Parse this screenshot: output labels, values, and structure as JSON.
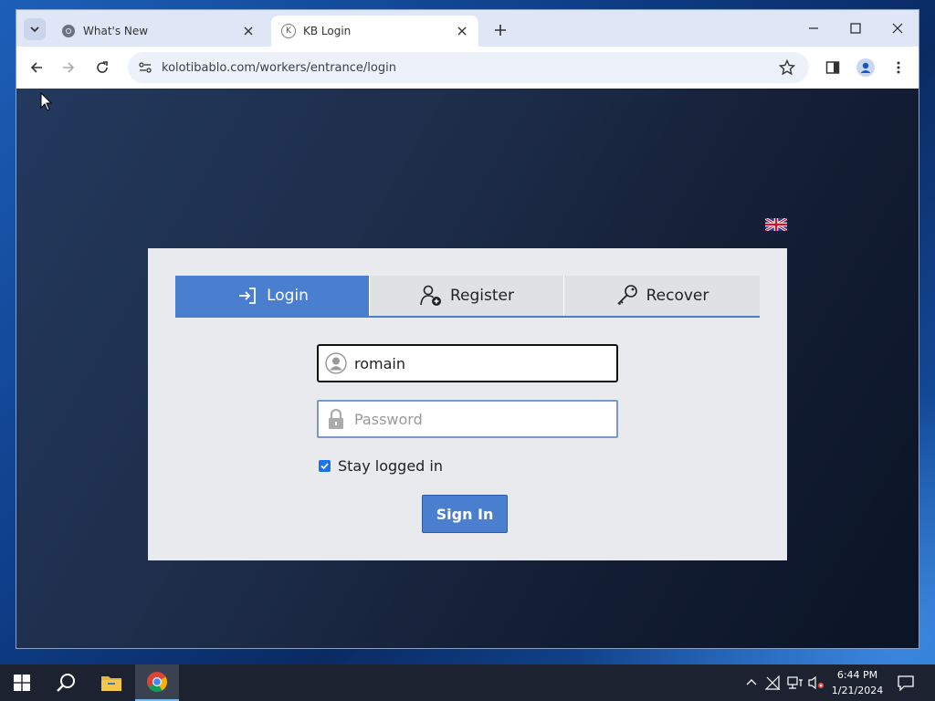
{
  "browser": {
    "tabs": [
      {
        "title": "What's New",
        "favicon": "chrome-icon"
      },
      {
        "title": "KB Login",
        "favicon": "k-logo-icon"
      }
    ],
    "url": "kolotibablo.com/workers/entrance/login"
  },
  "page": {
    "language_flag": "uk-flag-icon",
    "tabs": {
      "login": "Login",
      "register": "Register",
      "recover": "Recover"
    },
    "username": {
      "value": "romain"
    },
    "password": {
      "placeholder": "Password",
      "value": ""
    },
    "stay_logged_in": {
      "label": "Stay logged in",
      "checked": true
    },
    "sign_in_label": "Sign In",
    "colors": {
      "accent": "#4a7fd0",
      "panel": "#e8eaee"
    }
  },
  "taskbar": {
    "time": "6:44 PM",
    "date": "1/21/2024"
  }
}
